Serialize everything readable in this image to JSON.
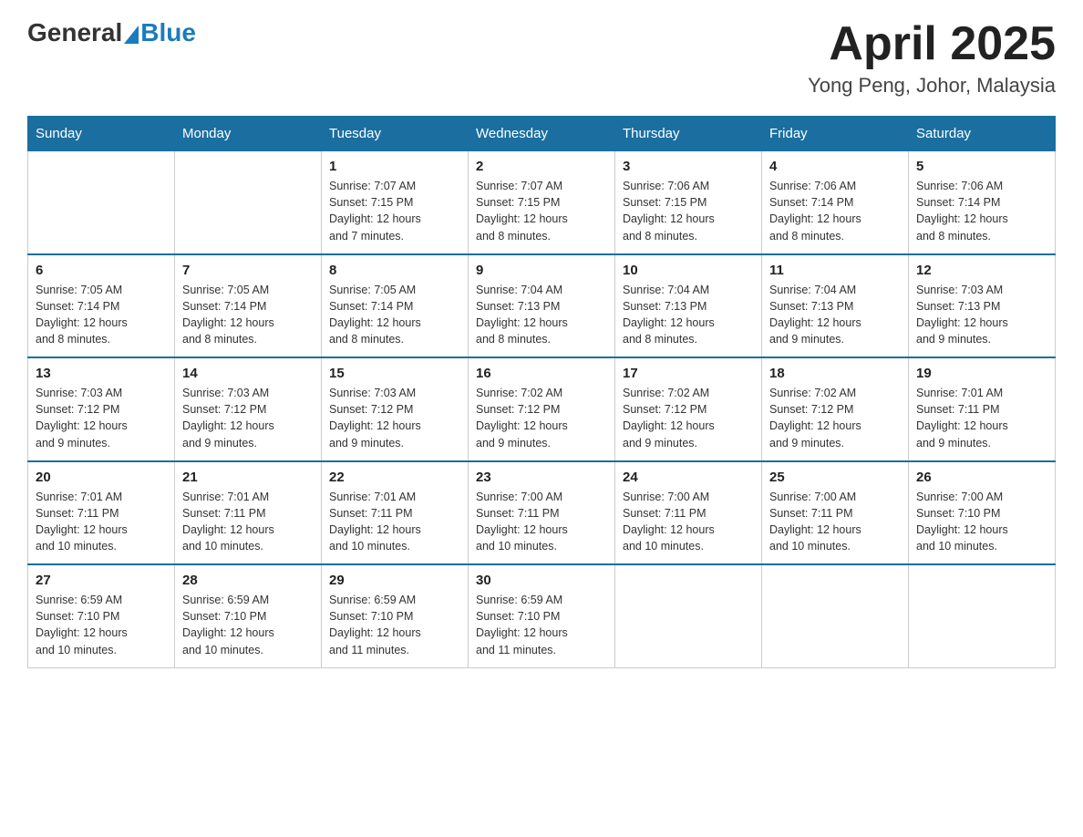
{
  "header": {
    "title": "April 2025",
    "location": "Yong Peng, Johor, Malaysia",
    "logo_general": "General",
    "logo_blue": "Blue"
  },
  "days_of_week": [
    "Sunday",
    "Monday",
    "Tuesday",
    "Wednesday",
    "Thursday",
    "Friday",
    "Saturday"
  ],
  "weeks": [
    {
      "days": [
        {
          "number": "",
          "info": ""
        },
        {
          "number": "",
          "info": ""
        },
        {
          "number": "1",
          "info": "Sunrise: 7:07 AM\nSunset: 7:15 PM\nDaylight: 12 hours\nand 7 minutes."
        },
        {
          "number": "2",
          "info": "Sunrise: 7:07 AM\nSunset: 7:15 PM\nDaylight: 12 hours\nand 8 minutes."
        },
        {
          "number": "3",
          "info": "Sunrise: 7:06 AM\nSunset: 7:15 PM\nDaylight: 12 hours\nand 8 minutes."
        },
        {
          "number": "4",
          "info": "Sunrise: 7:06 AM\nSunset: 7:14 PM\nDaylight: 12 hours\nand 8 minutes."
        },
        {
          "number": "5",
          "info": "Sunrise: 7:06 AM\nSunset: 7:14 PM\nDaylight: 12 hours\nand 8 minutes."
        }
      ]
    },
    {
      "days": [
        {
          "number": "6",
          "info": "Sunrise: 7:05 AM\nSunset: 7:14 PM\nDaylight: 12 hours\nand 8 minutes."
        },
        {
          "number": "7",
          "info": "Sunrise: 7:05 AM\nSunset: 7:14 PM\nDaylight: 12 hours\nand 8 minutes."
        },
        {
          "number": "8",
          "info": "Sunrise: 7:05 AM\nSunset: 7:14 PM\nDaylight: 12 hours\nand 8 minutes."
        },
        {
          "number": "9",
          "info": "Sunrise: 7:04 AM\nSunset: 7:13 PM\nDaylight: 12 hours\nand 8 minutes."
        },
        {
          "number": "10",
          "info": "Sunrise: 7:04 AM\nSunset: 7:13 PM\nDaylight: 12 hours\nand 8 minutes."
        },
        {
          "number": "11",
          "info": "Sunrise: 7:04 AM\nSunset: 7:13 PM\nDaylight: 12 hours\nand 9 minutes."
        },
        {
          "number": "12",
          "info": "Sunrise: 7:03 AM\nSunset: 7:13 PM\nDaylight: 12 hours\nand 9 minutes."
        }
      ]
    },
    {
      "days": [
        {
          "number": "13",
          "info": "Sunrise: 7:03 AM\nSunset: 7:12 PM\nDaylight: 12 hours\nand 9 minutes."
        },
        {
          "number": "14",
          "info": "Sunrise: 7:03 AM\nSunset: 7:12 PM\nDaylight: 12 hours\nand 9 minutes."
        },
        {
          "number": "15",
          "info": "Sunrise: 7:03 AM\nSunset: 7:12 PM\nDaylight: 12 hours\nand 9 minutes."
        },
        {
          "number": "16",
          "info": "Sunrise: 7:02 AM\nSunset: 7:12 PM\nDaylight: 12 hours\nand 9 minutes."
        },
        {
          "number": "17",
          "info": "Sunrise: 7:02 AM\nSunset: 7:12 PM\nDaylight: 12 hours\nand 9 minutes."
        },
        {
          "number": "18",
          "info": "Sunrise: 7:02 AM\nSunset: 7:12 PM\nDaylight: 12 hours\nand 9 minutes."
        },
        {
          "number": "19",
          "info": "Sunrise: 7:01 AM\nSunset: 7:11 PM\nDaylight: 12 hours\nand 9 minutes."
        }
      ]
    },
    {
      "days": [
        {
          "number": "20",
          "info": "Sunrise: 7:01 AM\nSunset: 7:11 PM\nDaylight: 12 hours\nand 10 minutes."
        },
        {
          "number": "21",
          "info": "Sunrise: 7:01 AM\nSunset: 7:11 PM\nDaylight: 12 hours\nand 10 minutes."
        },
        {
          "number": "22",
          "info": "Sunrise: 7:01 AM\nSunset: 7:11 PM\nDaylight: 12 hours\nand 10 minutes."
        },
        {
          "number": "23",
          "info": "Sunrise: 7:00 AM\nSunset: 7:11 PM\nDaylight: 12 hours\nand 10 minutes."
        },
        {
          "number": "24",
          "info": "Sunrise: 7:00 AM\nSunset: 7:11 PM\nDaylight: 12 hours\nand 10 minutes."
        },
        {
          "number": "25",
          "info": "Sunrise: 7:00 AM\nSunset: 7:11 PM\nDaylight: 12 hours\nand 10 minutes."
        },
        {
          "number": "26",
          "info": "Sunrise: 7:00 AM\nSunset: 7:10 PM\nDaylight: 12 hours\nand 10 minutes."
        }
      ]
    },
    {
      "days": [
        {
          "number": "27",
          "info": "Sunrise: 6:59 AM\nSunset: 7:10 PM\nDaylight: 12 hours\nand 10 minutes."
        },
        {
          "number": "28",
          "info": "Sunrise: 6:59 AM\nSunset: 7:10 PM\nDaylight: 12 hours\nand 10 minutes."
        },
        {
          "number": "29",
          "info": "Sunrise: 6:59 AM\nSunset: 7:10 PM\nDaylight: 12 hours\nand 11 minutes."
        },
        {
          "number": "30",
          "info": "Sunrise: 6:59 AM\nSunset: 7:10 PM\nDaylight: 12 hours\nand 11 minutes."
        },
        {
          "number": "",
          "info": ""
        },
        {
          "number": "",
          "info": ""
        },
        {
          "number": "",
          "info": ""
        }
      ]
    }
  ]
}
